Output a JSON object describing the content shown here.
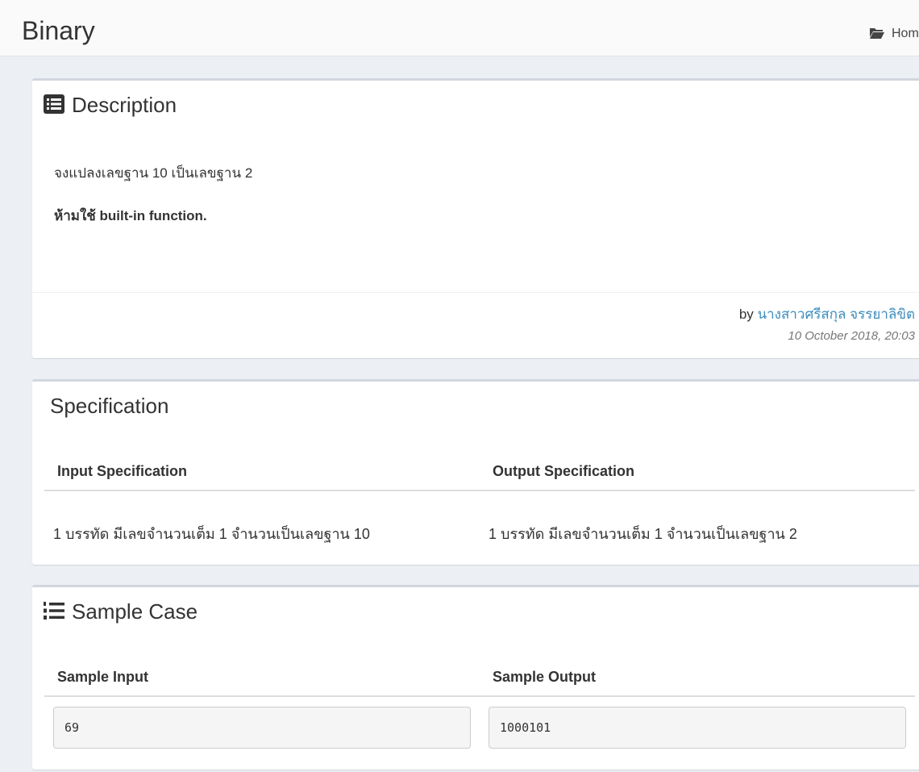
{
  "header": {
    "title": "Binary",
    "breadcrumb_home": "Hom"
  },
  "description": {
    "title": "Description",
    "line1": "จงแปลงเลขฐาน 10 เป็นเลขฐาน 2",
    "line2": "ห้ามใช้ built-in function.",
    "by_label": "by",
    "author": "นางสาวศรีสกุล จรรยาลิขิต",
    "date": "10 October 2018, 20:03"
  },
  "specification": {
    "title": "Specification",
    "input_header": "Input Specification",
    "output_header": "Output Specification",
    "input_text": "1 บรรทัด มีเลขจำนวนเต็ม 1 จำนวนเป็นเลขฐาน 10",
    "output_text": "1 บรรทัด มีเลขจำนวนเต็ม 1 จำนวนเป็นเลขฐาน 2"
  },
  "sample_case": {
    "title": "Sample Case",
    "input_header": "Sample Input",
    "output_header": "Sample Output",
    "input_value": "69",
    "output_value": "1000101"
  },
  "icons": {
    "breadcrumb": "folder-open-icon",
    "description": "list-alt-icon",
    "sample_case": "list-ol-icon"
  },
  "colors": {
    "link": "#3c8dbc",
    "box_border": "#d2d6de",
    "background": "#ecf0f5"
  }
}
